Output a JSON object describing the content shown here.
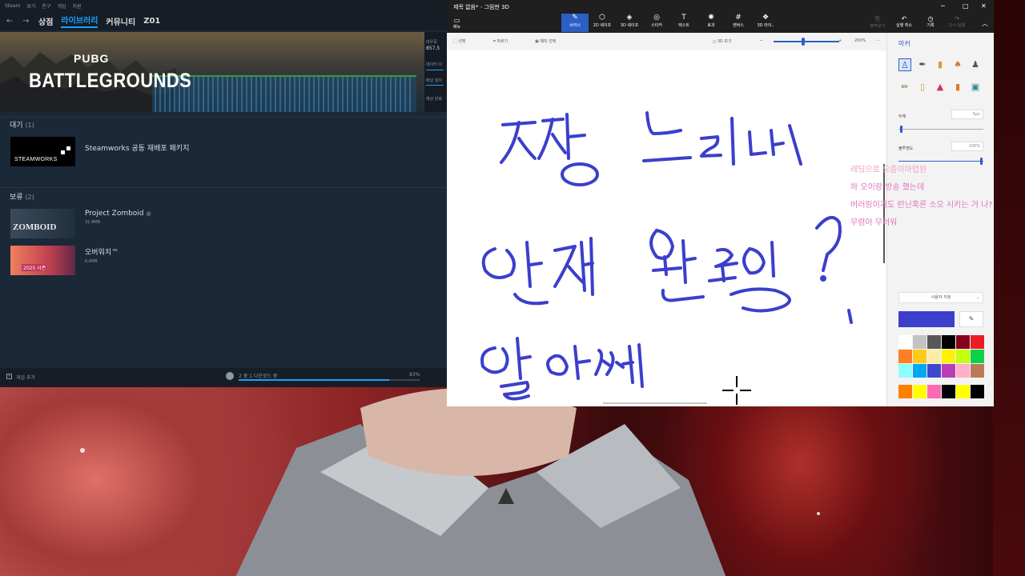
{
  "steam": {
    "titlebar": [
      "Steam",
      "보기",
      "친구",
      "게임",
      "지원"
    ],
    "nav": {
      "back": "←",
      "forward": "→",
      "tabs": [
        "상점",
        "라이브러리",
        "커뮤니티",
        "Z01"
      ],
      "active_tab": 1
    },
    "banner": {
      "logo_top": "PUBG",
      "logo_main": "BATTLEGROUNDS"
    },
    "side_panel": {
      "line1": "대우중",
      "line2": "857,5",
      "line3": "데이터 다",
      "line4": "패널 설치",
      "line5": "예상 완료"
    },
    "waiting": {
      "title": "대기",
      "count": "(1)",
      "items": [
        {
          "name": "Steamworks 공동 재배포 패키지",
          "thumb_text": "STEAMWORKS"
        }
      ]
    },
    "on_hold": {
      "title": "보류",
      "count": "(2)",
      "items": [
        {
          "name": "Project Zomboid",
          "sub": "31.9MB",
          "thumb_text": "ZOMBOID"
        },
        {
          "name": "오버워치™",
          "sub": "6.6MB",
          "thumb_text": "2025 시즌"
        }
      ]
    },
    "footer": {
      "add_game": "게임 추가",
      "download_status": "2 중 1 다운로드 중",
      "progress_percent": 83,
      "progress_label": "83%"
    }
  },
  "paint": {
    "title": "제목 없음* - 그림판 3D",
    "menu_label": "메뉴",
    "tools": [
      {
        "label": "브러시",
        "icon": "✎"
      },
      {
        "label": "2D 셰이프",
        "icon": "⬡"
      },
      {
        "label": "3D 셰이프",
        "icon": "◈"
      },
      {
        "label": "스티커",
        "icon": "◎"
      },
      {
        "label": "텍스트",
        "icon": "T"
      },
      {
        "label": "효과",
        "icon": "✺"
      },
      {
        "label": "캔버스",
        "icon": "#"
      },
      {
        "label": "3D 라이..",
        "icon": "❖"
      }
    ],
    "right_tools": [
      {
        "label": "붙여넣기",
        "icon": "⎘",
        "dim": true
      },
      {
        "label": "실행 취소",
        "icon": "↶",
        "dim": false
      },
      {
        "label": "기록",
        "icon": "◷",
        "dim": false
      },
      {
        "label": "다시 실행",
        "icon": "↷",
        "dim": true
      }
    ],
    "window_controls": {
      "minimize": "─",
      "maximize": "□",
      "close": "✕",
      "collapse": "︿"
    },
    "subbar": {
      "select": "선택",
      "crop": "자르기",
      "magic_select": "매직 선택",
      "view_3d": "3D 보기",
      "zoom_minus": "─",
      "zoom_plus": "+",
      "zoom_level": "200%",
      "more": "···"
    },
    "panel": {
      "title": "마커",
      "thickness_label": "두께",
      "thickness_value": "5px",
      "opacity_label": "불투명도",
      "opacity_value": "100%",
      "custom_color": "사용자 지정",
      "current_color": "#3b3fcc",
      "eyedropper_icon": "eyedropper-icon",
      "swatches": [
        "#ffffff",
        "#c3c3c3",
        "#585858",
        "#000000",
        "#88001b",
        "#ec1c24",
        "#ff7f27",
        "#ffca18",
        "#fdeca6",
        "#fff200",
        "#c4ff0e",
        "#0ed145",
        "#8cfffb",
        "#00a8f3",
        "#3f48cc",
        "#b83dba",
        "#ffaec8",
        "#b97a56",
        "#ff7f00",
        "#ffff00",
        "#ff69b4",
        "#000000",
        "#ffff00",
        "#000000"
      ]
    }
  },
  "chat": [
    "레딩으로 오줌이마렵뭔",
    "하 오이랑 방송 했는데",
    "버러링이거도 런닌혹른 소오 시키는 거 나?",
    "무렴아 무러워"
  ]
}
